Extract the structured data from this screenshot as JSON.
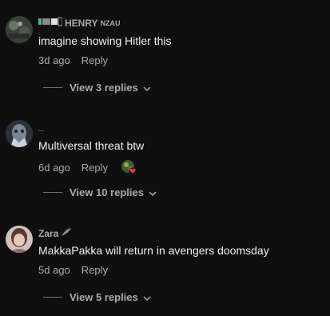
{
  "comments": [
    {
      "author": "HENRY",
      "author_suffix": "NZAU",
      "text": "imagine showing Hitler this",
      "time": "3d ago",
      "reply_label": "Reply",
      "replies_label": "View 3 replies"
    },
    {
      "author": "_",
      "text": "Multiversal threat btw",
      "time": "6d ago",
      "reply_label": "Reply",
      "replies_label": "View 10 replies",
      "has_creator_heart": true
    },
    {
      "author": "Zara",
      "text": "MakkaPakka will return in avengers doomsday",
      "time": "5d ago",
      "reply_label": "Reply",
      "replies_label": "View 5 replies"
    }
  ],
  "icons": {
    "chevron": "chevron-down-icon",
    "heart": "heart-icon"
  },
  "colors": {
    "background": "#0f0f0f",
    "text_primary": "#f1f1f1",
    "text_secondary": "#aaaaaa",
    "heart": "#e53935"
  }
}
